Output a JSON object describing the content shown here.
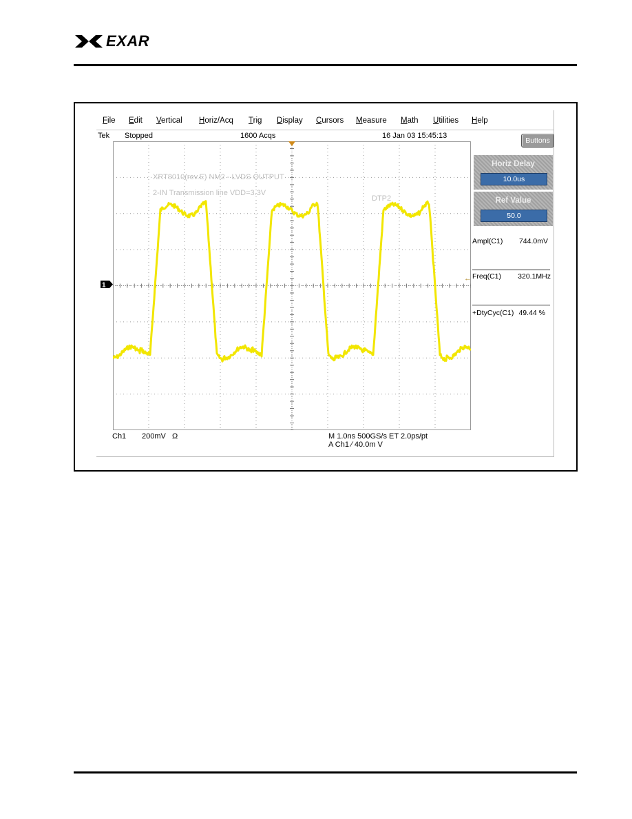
{
  "header": {
    "logo_text": "EXAR"
  },
  "scope": {
    "menu": [
      "File",
      "Edit",
      "Vertical",
      "Horiz/Acq",
      "Trig",
      "Display",
      "Cursors",
      "Measure",
      "Math",
      "Utilities",
      "Help"
    ],
    "status": {
      "brand": "Tek",
      "state": "Stopped",
      "acqs": "1600 Acqs",
      "datetime": "16 Jan 03 15:45:13"
    },
    "annotations": {
      "line1": "XRT8010(rev.E) NM2 - LVDS OUTPUT",
      "line2": "2-IN Transmission line VDD=3.3V",
      "probe": "DTP2"
    },
    "channel_marker": "1",
    "buttons_label": "Buttons",
    "controls": [
      {
        "title": "Horiz Delay",
        "value": "10.0us"
      },
      {
        "title": "Ref Value",
        "value": "50.0"
      }
    ],
    "measurements": [
      {
        "label": "Ampl(C1)",
        "value": "744.0mV"
      },
      {
        "label": "Freq(C1)",
        "value": "320.1MHz"
      },
      {
        "label": "+DtyCyc(C1)",
        "value": "49.44 %"
      }
    ],
    "bottom": {
      "channel": "Ch1",
      "scale": "200mV",
      "impedance": "Ω",
      "timebase": "M 1.0ns 500GS/s ET 2.0ps/pt",
      "trigger": "A  Ch1  ∕  40.0m  V"
    },
    "colors": {
      "trace": "#f2e600",
      "grid": "#9a9a9a",
      "control_value_bg": "#3b6ca8",
      "trigger_marker": "#d08a1a"
    }
  }
}
